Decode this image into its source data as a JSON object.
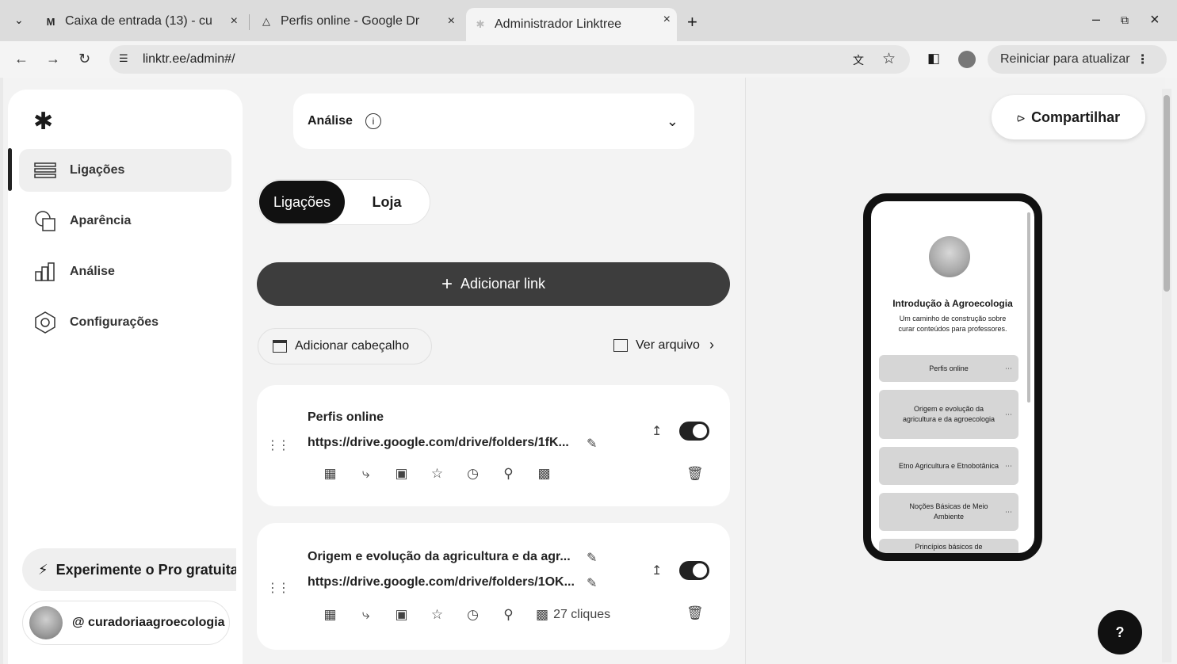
{
  "browser": {
    "tabs": [
      {
        "title": "Caixa de entrada (13) - cu",
        "icon": "gmail-icon"
      },
      {
        "title": "Perfis online - Google Dr",
        "icon": "drive-icon"
      },
      {
        "title": "Administrador Linktree",
        "icon": "linktree-icon"
      }
    ],
    "new_tab": "+",
    "url": "linktr.ee/admin#/",
    "restart_label": "Reiniciar para atualizar"
  },
  "sidebar": {
    "items": [
      {
        "label": "Ligações",
        "icon": "links-icon"
      },
      {
        "label": "Aparência",
        "icon": "appearance-icon"
      },
      {
        "label": "Análise",
        "icon": "analytics-icon"
      },
      {
        "label": "Configurações",
        "icon": "settings-icon"
      }
    ],
    "pro_label": "Experimente o Pro gratuita",
    "account": "@ curadoriaagroecologia"
  },
  "main": {
    "analise_label": "Análise",
    "tabs": [
      "Ligações",
      "Loja"
    ],
    "add_link": "Adicionar link",
    "add_header": "Adicionar cabeçalho",
    "archive": "Ver arquivo",
    "cards": [
      {
        "title": "Perfis online",
        "url": "https://drive.google.com/drive/folders/1fK...",
        "clicks": ""
      },
      {
        "title": "Origem e evolução da agricultura e da agr...",
        "url": "https://drive.google.com/drive/folders/1OK...",
        "clicks": "27 cliques"
      }
    ]
  },
  "preview": {
    "share_label": "Compartilhar",
    "title": "Introdução à Agroecologia",
    "subtitle": "Um caminho de construção sobre curar conteúdos para professores.",
    "links": [
      "Perfis online",
      "Origem e evolução da agricultura e da agroecologia",
      "Etno Agricultura e Etnobotânica",
      "Noções Básicas de Meio Ambiente",
      "Princípios básicos de"
    ]
  },
  "help_label": "?"
}
